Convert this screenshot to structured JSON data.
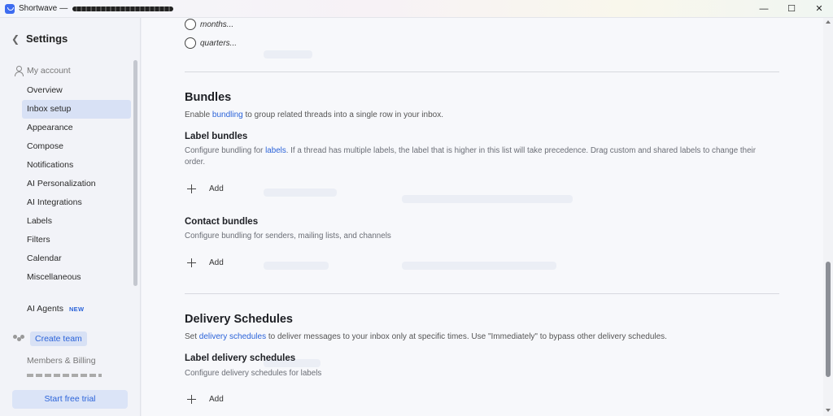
{
  "titlebar": {
    "app_name": "Shortwave",
    "separator": "—"
  },
  "sidebar": {
    "back_icon": "chevron-left-icon",
    "title": "Settings",
    "section_label": "My account",
    "items": [
      {
        "label": "Overview"
      },
      {
        "label": "Inbox setup",
        "active": true
      },
      {
        "label": "Appearance"
      },
      {
        "label": "Compose"
      },
      {
        "label": "Notifications"
      },
      {
        "label": "AI Personalization"
      },
      {
        "label": "AI Integrations"
      },
      {
        "label": "Labels"
      },
      {
        "label": "Filters"
      },
      {
        "label": "Calendar"
      },
      {
        "label": "Miscellaneous"
      }
    ],
    "agents_label": "AI Agents",
    "new_badge": "NEW",
    "create_team": "Create team",
    "members_billing": "Members & Billing",
    "trial_button": "Start free trial"
  },
  "main": {
    "radio_options": [
      "months...",
      "quarters..."
    ],
    "bundles": {
      "title": "Bundles",
      "desc_pre": "Enable ",
      "desc_link": "bundling",
      "desc_post": " to group related threads into a single row in your inbox.",
      "label_bundles": {
        "title": "Label bundles",
        "desc_pre": "Configure bundling for ",
        "desc_link": "labels",
        "desc_post": ". If a thread has multiple labels, the label that is higher in this list will take precedence. Drag custom and shared labels to change their order.",
        "add_label": "Add"
      },
      "contact_bundles": {
        "title": "Contact bundles",
        "desc": "Configure bundling for senders, mailing lists, and channels",
        "add_label": "Add"
      }
    },
    "delivery": {
      "title": "Delivery Schedules",
      "desc_pre": "Set ",
      "desc_link": "delivery schedules",
      "desc_post": " to deliver messages to your inbox only at specific times. Use \"Immediately\" to bypass other delivery schedules.",
      "label_schedules": {
        "title": "Label delivery schedules",
        "desc": "Configure delivery schedules for labels",
        "add_label": "Add"
      }
    }
  },
  "window_controls": {
    "minimize": "—",
    "maximize": "☐",
    "close": "✕"
  }
}
